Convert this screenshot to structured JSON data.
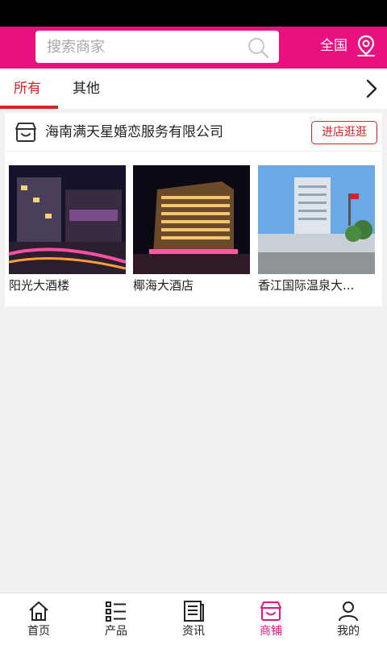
{
  "header": {
    "search_placeholder": "搜索商家",
    "region": "全国"
  },
  "tabs": [
    {
      "label": "所有",
      "active": true
    },
    {
      "label": "其他",
      "active": false
    }
  ],
  "shop": {
    "name": "海南满天星婚恋服务有限公司",
    "visit_label": "进店逛逛",
    "products": [
      {
        "name": "阳光大酒楼"
      },
      {
        "name": "椰海大酒店"
      },
      {
        "name": "香江国际温泉大..."
      }
    ]
  },
  "nav": [
    {
      "label": "首页",
      "icon": "home-icon"
    },
    {
      "label": "产品",
      "icon": "list-icon"
    },
    {
      "label": "资讯",
      "icon": "news-icon"
    },
    {
      "label": "商铺",
      "icon": "shop-icon",
      "active": true
    },
    {
      "label": "我的",
      "icon": "user-icon"
    }
  ],
  "colors": {
    "brand": "#e8117f",
    "accent": "#d9221f"
  }
}
